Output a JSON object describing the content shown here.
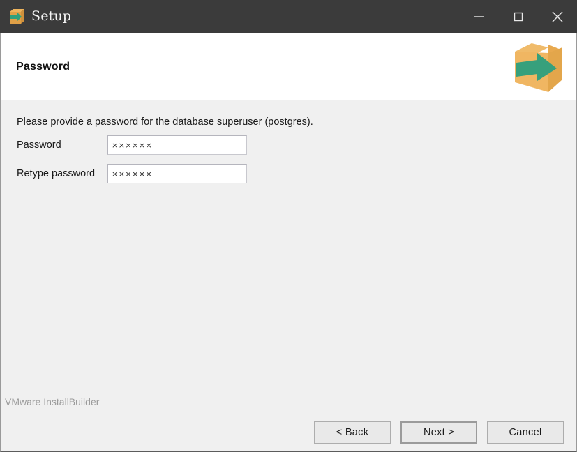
{
  "window": {
    "title": "Setup",
    "icon": "installer-box-icon",
    "controls": [
      {
        "name": "minimize-button",
        "glyph": "minimize-icon"
      },
      {
        "name": "maximize-button",
        "glyph": "maximize-icon"
      },
      {
        "name": "close-button",
        "glyph": "close-icon"
      }
    ]
  },
  "header": {
    "title": "Password",
    "logo": "installer-box-logo"
  },
  "main": {
    "instruction": "Please provide a password for the database superuser (postgres).",
    "fields": [
      {
        "label": "Password",
        "value": "××××××",
        "placeholder": "",
        "focused": false
      },
      {
        "label": "Retype password",
        "value": "××××××",
        "placeholder": "",
        "focused": true
      }
    ]
  },
  "footer": {
    "brand": "VMware InstallBuilder",
    "buttons": {
      "back": "< Back",
      "next": "Next >",
      "cancel": "Cancel"
    }
  },
  "colors": {
    "titlebar_bg": "#3b3b3b",
    "titlebar_fg": "#f4f4f4",
    "header_bg": "#ffffff",
    "body_bg": "#f0f0f0",
    "box_orange": "#eeb45c",
    "box_orange_dark": "#e0a047",
    "arrow_green": "#37a07c",
    "brand_gray": "#9a9a9a"
  }
}
